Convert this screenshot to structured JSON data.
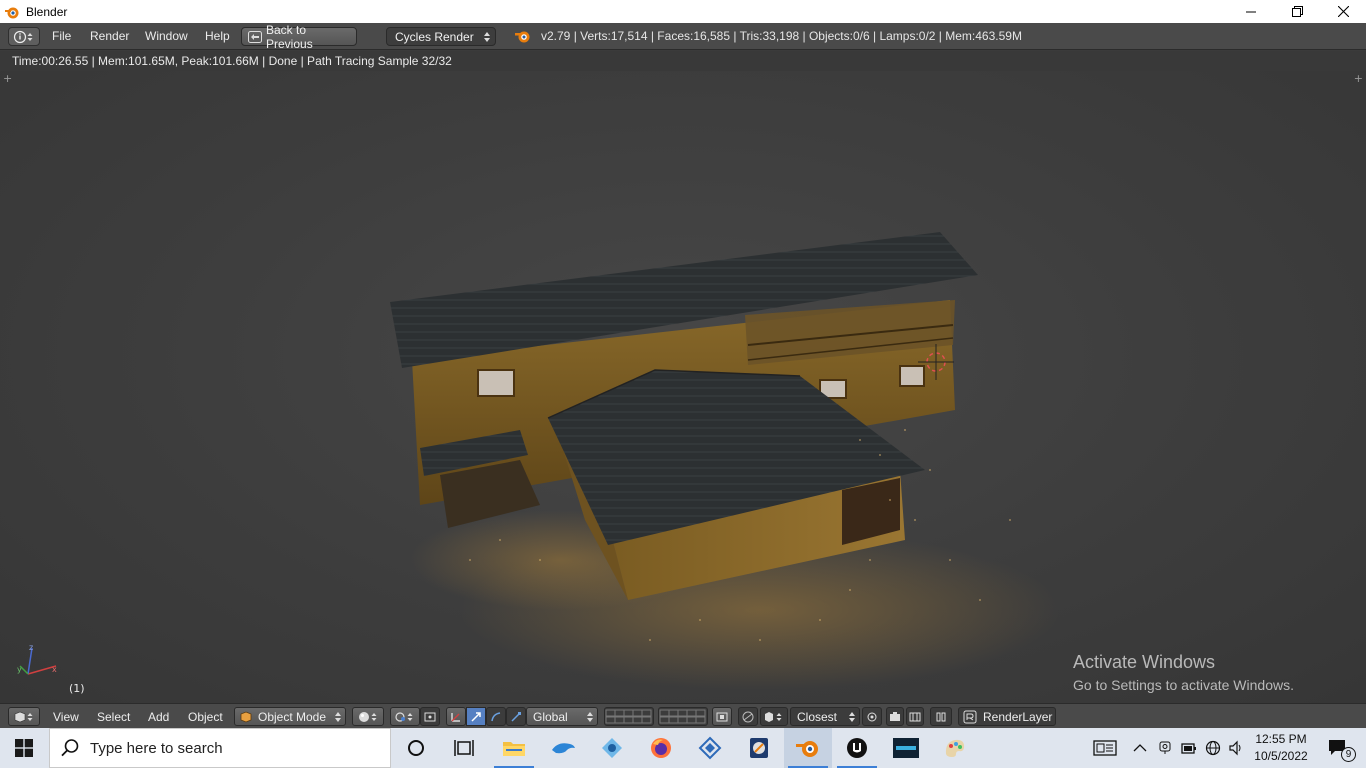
{
  "window": {
    "title": "Blender"
  },
  "info_header": {
    "menus": [
      "File",
      "Render",
      "Window",
      "Help"
    ],
    "back_button": "Back to Previous",
    "render_engine": "Cycles Render",
    "stats": "v2.79 | Verts:17,514 | Faces:16,585 | Tris:33,198 | Objects:0/6 | Lamps:0/2 | Mem:463.59M"
  },
  "render_status": "Time:00:26.55 | Mem:101.65M, Peak:101.66M | Done | Path Tracing Sample 32/32",
  "viewport": {
    "frame_label": "(1)",
    "watermark_title": "Activate Windows",
    "watermark_text": "Go to Settings to activate Windows."
  },
  "view3d_header": {
    "menus": [
      "View",
      "Select",
      "Add",
      "Object"
    ],
    "mode": "Object Mode",
    "orientation": "Global",
    "snap_target": "Closest",
    "render_layer": "RenderLayer"
  },
  "taskbar": {
    "search_placeholder": "Type here to search",
    "time": "12:55 PM",
    "date": "10/5/2022",
    "notification_count": "9",
    "apps": [
      "cortana-icon",
      "task-view-icon",
      "file-explorer-icon",
      "dolphin-app-icon",
      "app-icon",
      "firefox-icon",
      "app-icon-2",
      "app-icon-3",
      "blender-icon",
      "unreal-engine-icon",
      "app-icon-4",
      "paint-icon"
    ]
  },
  "colors": {
    "accent_blue": "#5680c2",
    "blender_orange": "#e87d0d"
  }
}
